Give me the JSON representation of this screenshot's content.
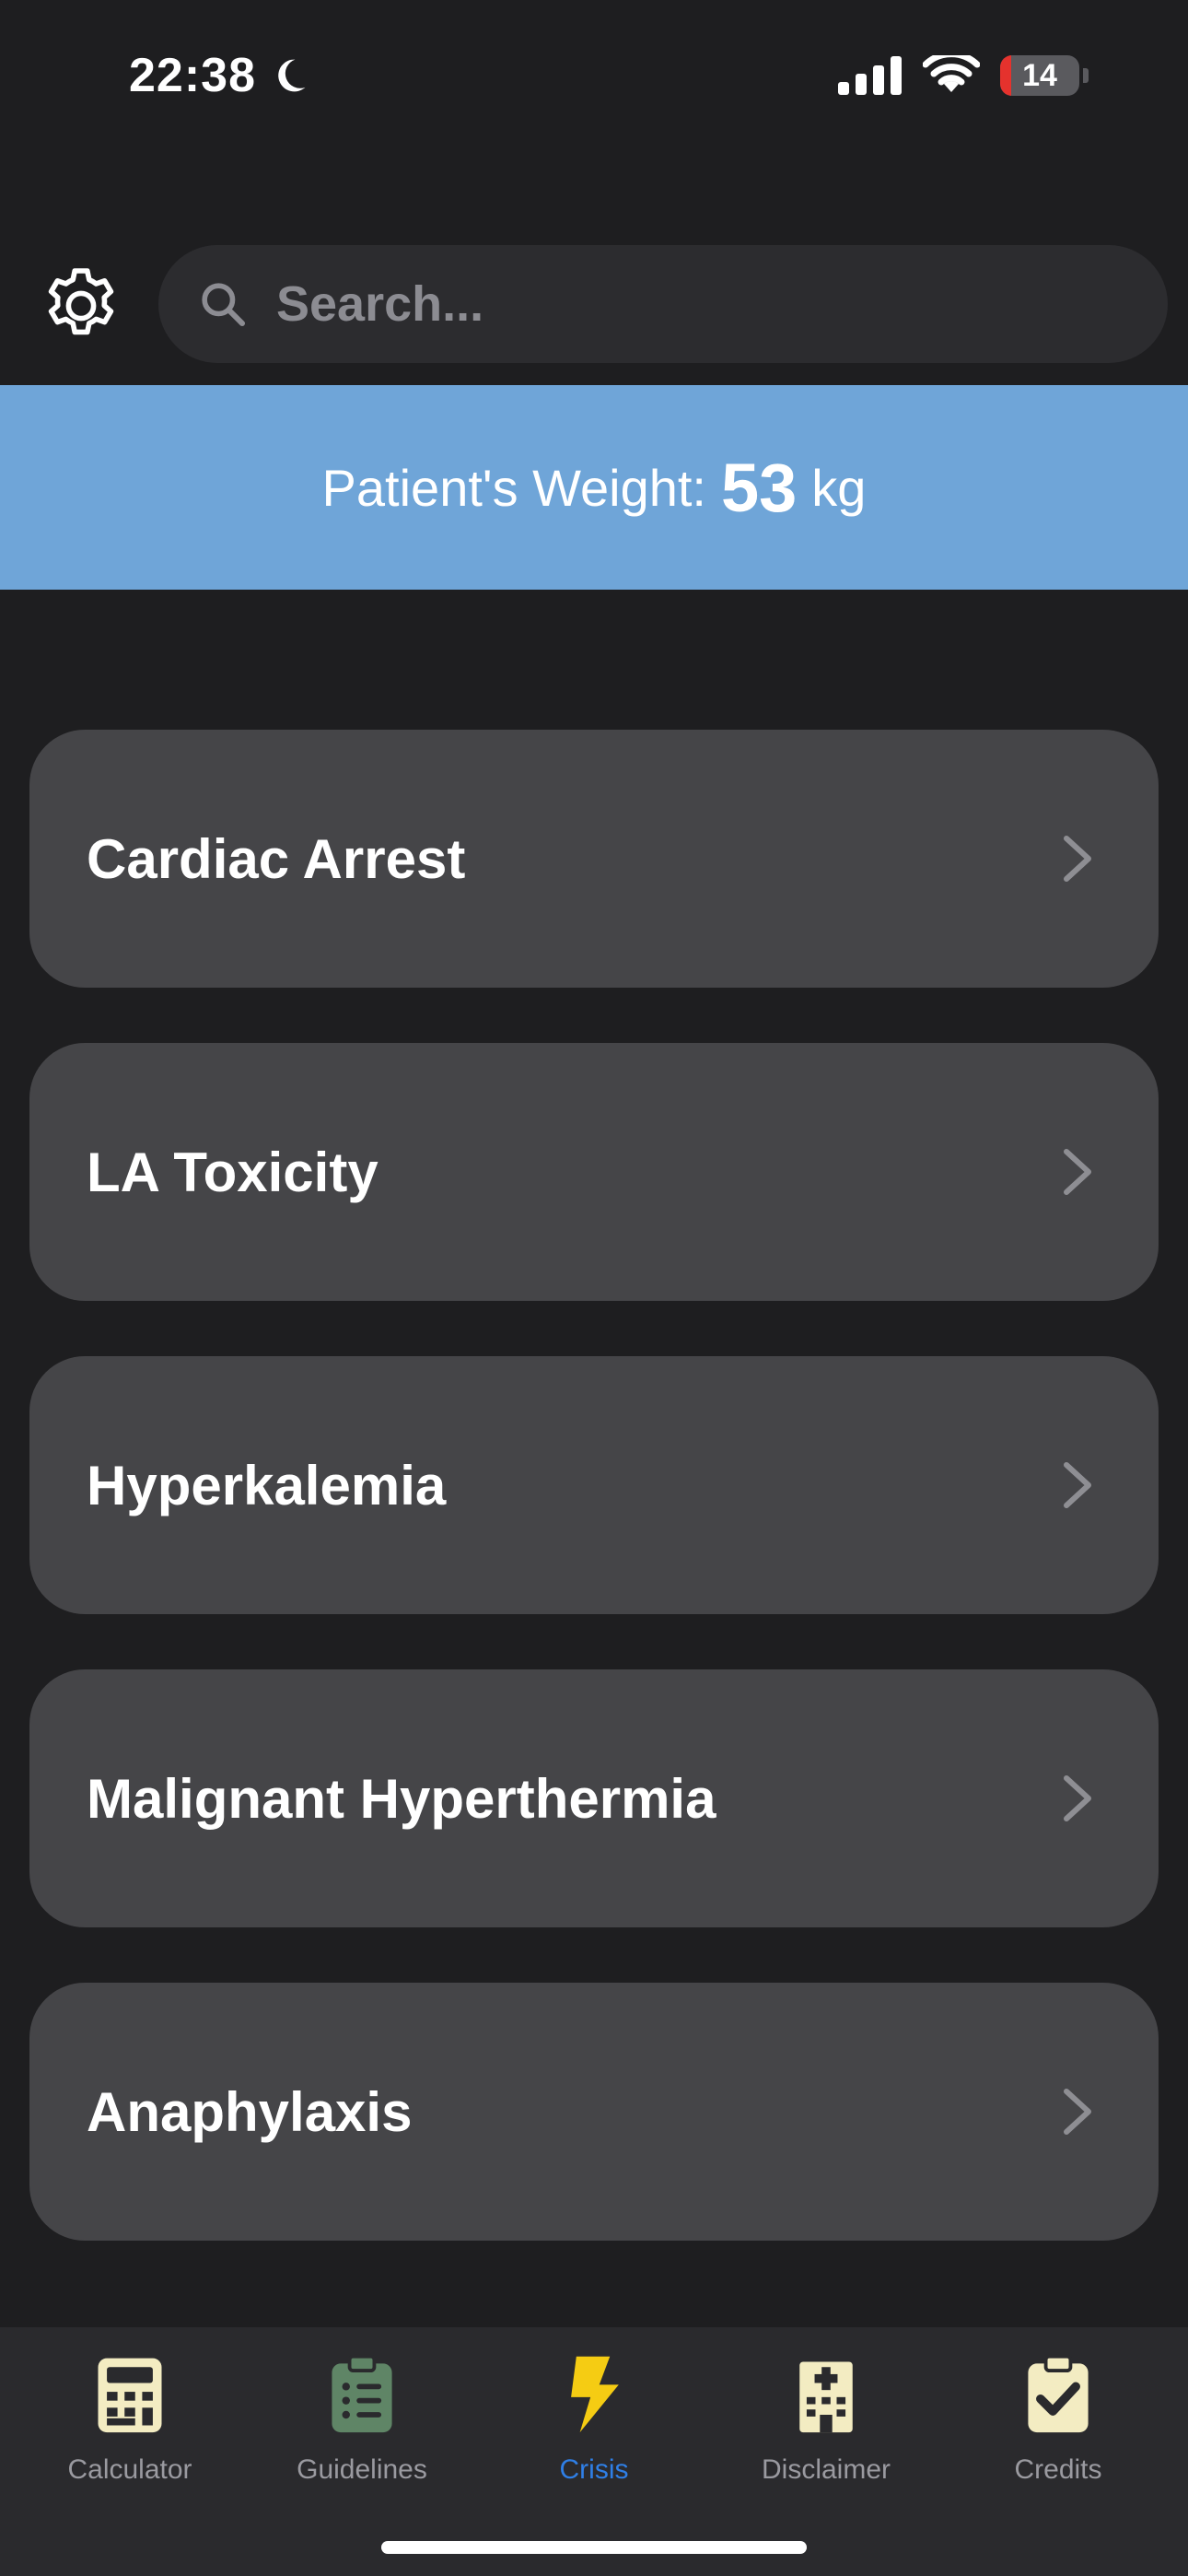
{
  "status_bar": {
    "time": "22:38",
    "battery_level": "14",
    "icons": [
      "moon-icon",
      "signal-icon",
      "wifi-icon",
      "battery-icon"
    ]
  },
  "search": {
    "placeholder": "Search..."
  },
  "weight_banner": {
    "label": "Patient's Weight:",
    "value": "53",
    "unit": "kg"
  },
  "crisis_list": {
    "items": [
      {
        "label": "Cardiac Arrest"
      },
      {
        "label": "LA Toxicity"
      },
      {
        "label": "Hyperkalemia"
      },
      {
        "label": "Malignant Hyperthermia"
      },
      {
        "label": "Anaphylaxis"
      }
    ]
  },
  "tab_bar": {
    "active": "Crisis",
    "tabs": [
      {
        "label": "Calculator",
        "icon": "calculator-icon"
      },
      {
        "label": "Guidelines",
        "icon": "clipboard-list-icon"
      },
      {
        "label": "Crisis",
        "icon": "lightning-bolt-icon"
      },
      {
        "label": "Disclaimer",
        "icon": "hospital-icon"
      },
      {
        "label": "Credits",
        "icon": "clipboard-check-icon"
      }
    ]
  },
  "colors": {
    "background": "#1e1e20",
    "banner": "#6fa5d8",
    "card": "#454548",
    "active_tab": "#2f7fe6",
    "bolt": "#f5cc13",
    "battery_low": "#e5322d"
  }
}
